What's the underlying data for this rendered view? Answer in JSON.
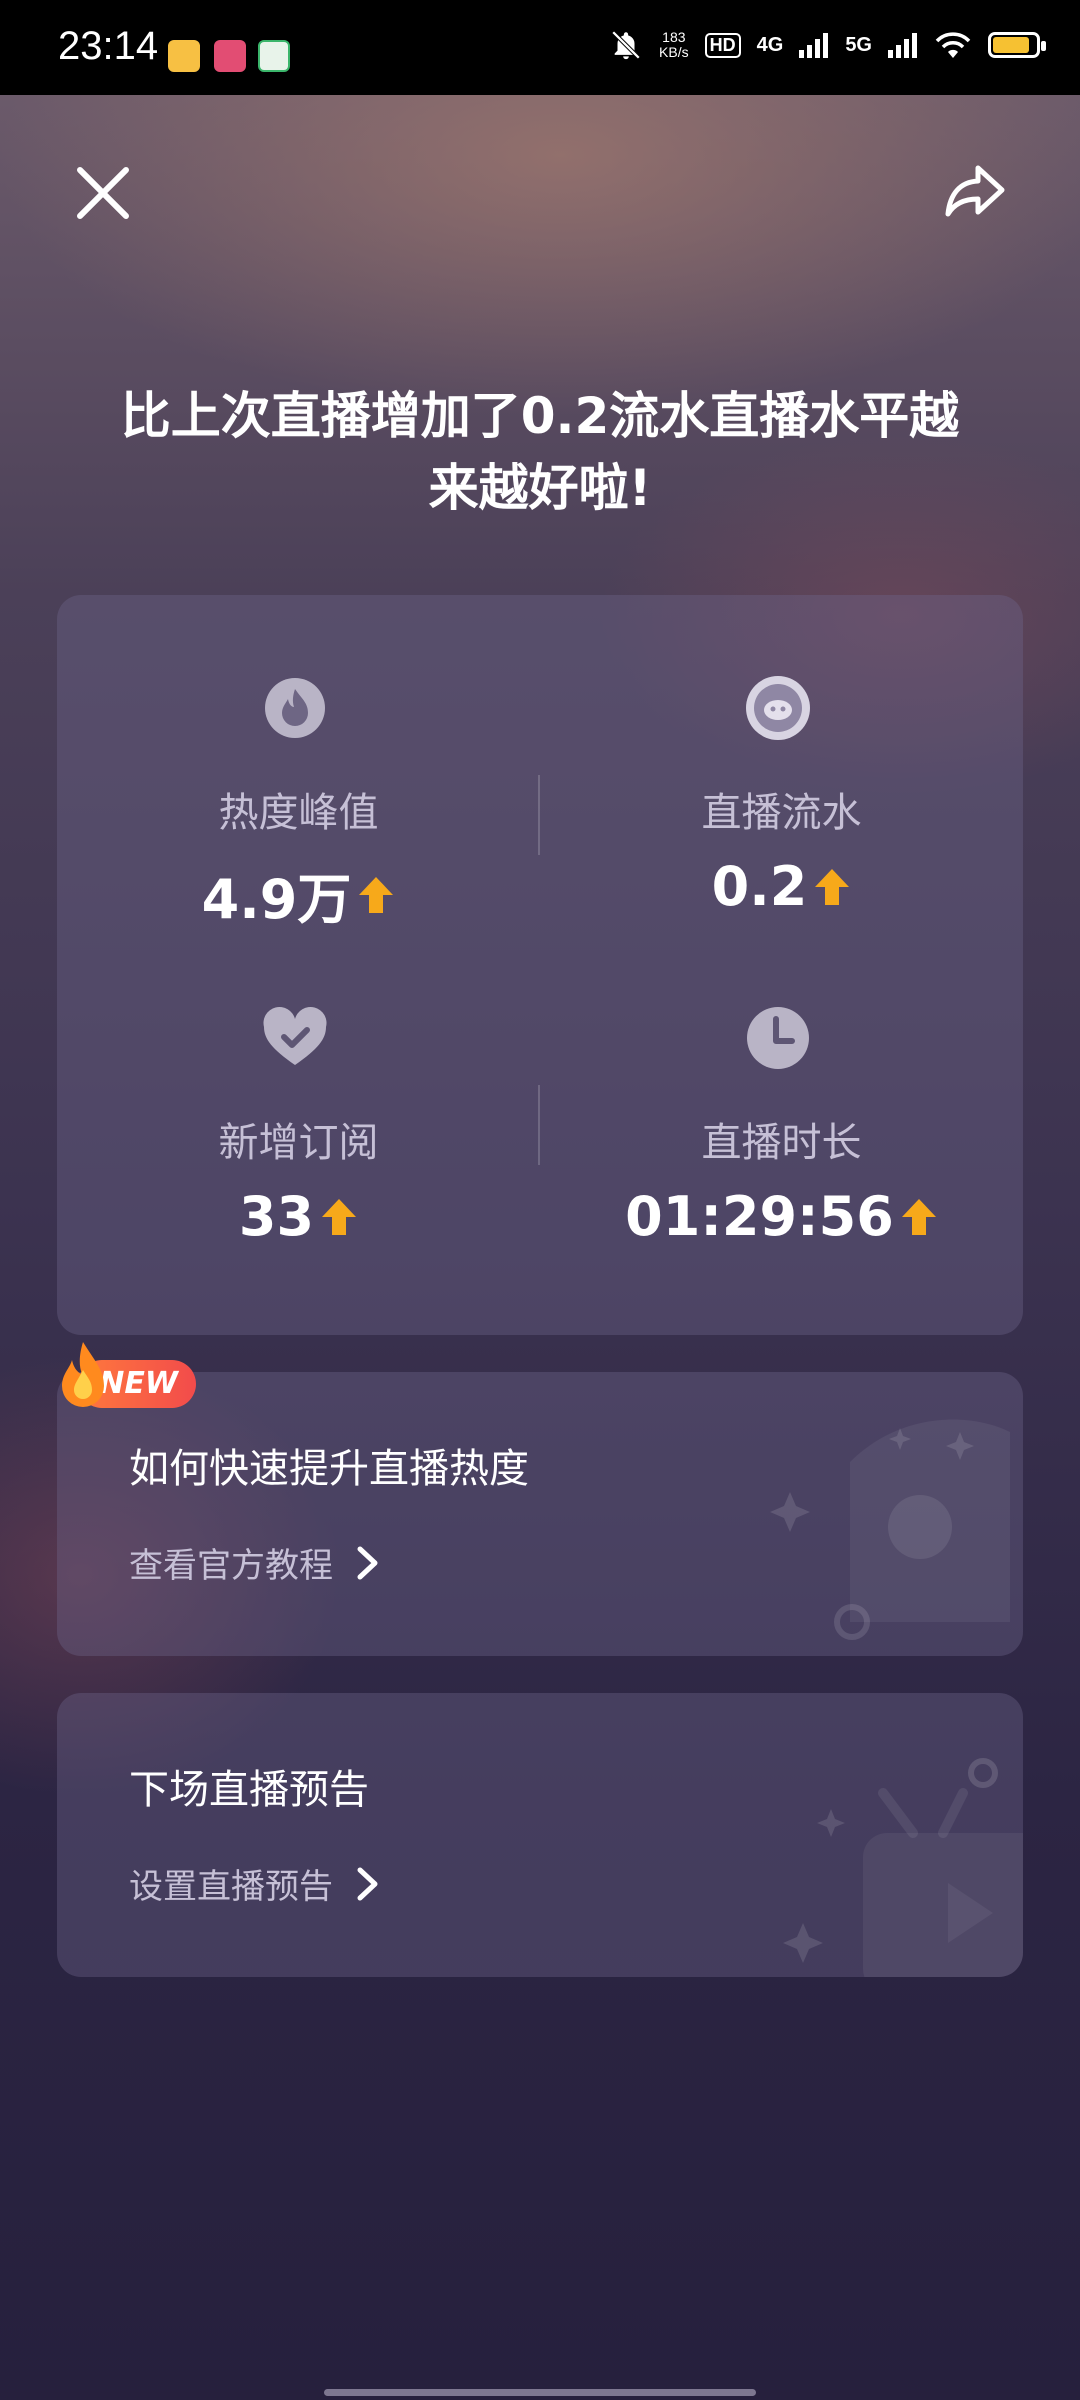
{
  "status_bar": {
    "time": "23:14",
    "net_speed_value": "183",
    "net_speed_unit": "KB/s",
    "hd_label": "HD",
    "net_4g": "4G",
    "net_5g": "5G",
    "battery_color": "#f6c132",
    "battery_level": 0.85
  },
  "header": {
    "close_icon": "close-icon",
    "share_icon": "share-icon"
  },
  "headline": "比上次直播增加了0.2流水直播水平越来越好啦!",
  "stats": [
    {
      "icon": "flame-icon",
      "label": "热度峰值",
      "value": "4.9万"
    },
    {
      "icon": "coin-icon",
      "label": "直播流水",
      "value": "0.2"
    },
    {
      "icon": "heart-check-icon",
      "label": "新增订阅",
      "value": "33"
    },
    {
      "icon": "clock-icon",
      "label": "直播时长",
      "value": "01:29:56"
    }
  ],
  "tutorial_card": {
    "badge": "NEW",
    "title": "如何快速提升直播热度",
    "link": "查看官方教程"
  },
  "preview_card": {
    "title": "下场直播预告",
    "link": "设置直播预告"
  },
  "colors": {
    "accent_arrow": "#f7a91a",
    "badge_gradient": [
      "#ff7a3d",
      "#f24b4b"
    ]
  }
}
